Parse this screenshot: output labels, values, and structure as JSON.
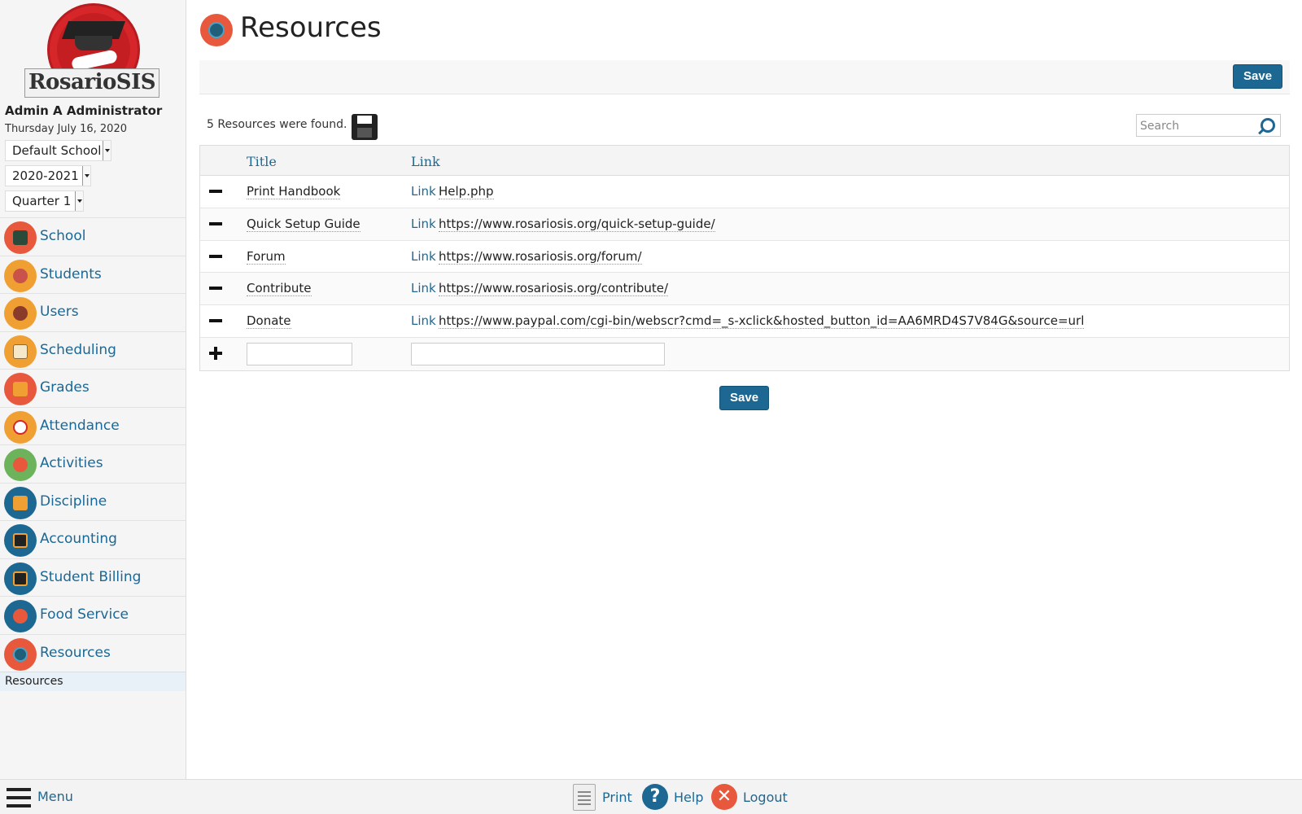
{
  "sidebar": {
    "logo_text": "RosarioSIS",
    "user_name": "Admin A Administrator",
    "date": "Thursday July 16, 2020",
    "school_select": "Default School",
    "year_select": "2020-2021",
    "term_select": "Quarter 1",
    "menu": [
      {
        "label": "School",
        "icon": "school-icon",
        "color": "#e8583d"
      },
      {
        "label": "Students",
        "icon": "students-icon",
        "color": "#f0a033"
      },
      {
        "label": "Users",
        "icon": "users-icon",
        "color": "#f0a033"
      },
      {
        "label": "Scheduling",
        "icon": "scheduling-icon",
        "color": "#f0a033"
      },
      {
        "label": "Grades",
        "icon": "grades-icon",
        "color": "#e8583d"
      },
      {
        "label": "Attendance",
        "icon": "attendance-icon",
        "color": "#f0a033"
      },
      {
        "label": "Activities",
        "icon": "activities-icon",
        "color": "#6cb35b"
      },
      {
        "label": "Discipline",
        "icon": "discipline-icon",
        "color": "#1d6893"
      },
      {
        "label": "Accounting",
        "icon": "accounting-icon",
        "color": "#1d6893"
      },
      {
        "label": "Student Billing",
        "icon": "billing-icon",
        "color": "#1d6893"
      },
      {
        "label": "Food Service",
        "icon": "food-icon",
        "color": "#1d6893"
      },
      {
        "label": "Resources",
        "icon": "resources-icon",
        "color": "#e8583d"
      }
    ],
    "submenu_active": "Resources"
  },
  "main": {
    "title": "Resources",
    "save_label": "Save",
    "found_text": "5 Resources were found.",
    "search_placeholder": "Search",
    "columns": {
      "title": "Title",
      "link": "Link"
    },
    "rows": [
      {
        "title": "Print Handbook",
        "link_text": "Link",
        "url": "Help.php"
      },
      {
        "title": "Quick Setup Guide",
        "link_text": "Link",
        "url": "https://www.rosariosis.org/quick-setup-guide/"
      },
      {
        "title": "Forum",
        "link_text": "Link",
        "url": "https://www.rosariosis.org/forum/"
      },
      {
        "title": "Contribute",
        "link_text": "Link",
        "url": "https://www.rosariosis.org/contribute/"
      },
      {
        "title": "Donate",
        "link_text": "Link",
        "url": "https://www.paypal.com/cgi-bin/webscr?cmd=_s-xclick&hosted_button_id=AA6MRD4S7V84G&source=url"
      }
    ]
  },
  "footer": {
    "menu_label": "Menu",
    "print_label": "Print",
    "help_label": "Help",
    "logout_label": "Logout"
  },
  "colors": {
    "accent": "#1d6893",
    "brand_red": "#d6262a"
  }
}
